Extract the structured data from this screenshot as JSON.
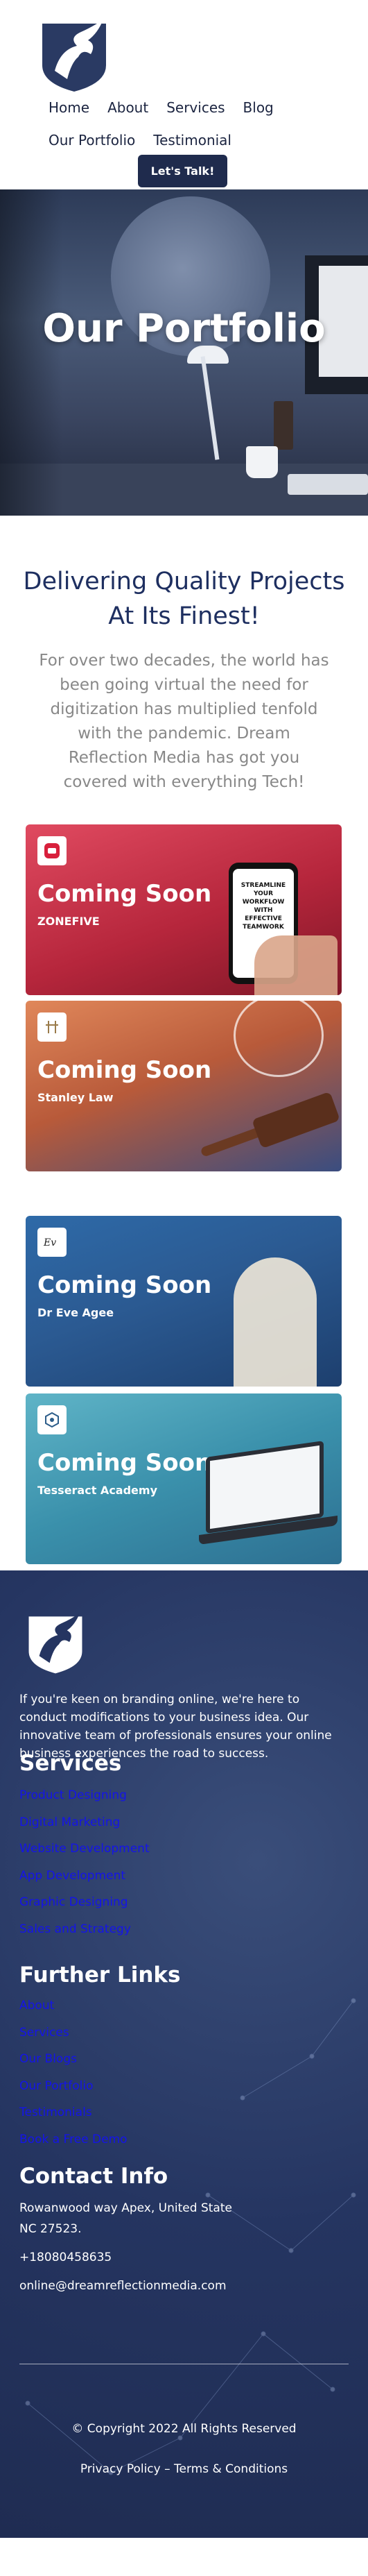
{
  "nav": {
    "row1": [
      "Home",
      "About",
      "Services",
      "Blog"
    ],
    "row2": [
      "Our Portfolio",
      "Testimonial"
    ],
    "cta": "Let's Talk!"
  },
  "hero": {
    "title": "Our Portfolio"
  },
  "intro": {
    "heading": "Delivering Quality Projects At Its Finest!",
    "body": "For over two decades, the world has been going virtual the need for digitization has multiplied tenfold with the pandemic. Dream Reflection Media has got you covered with everything Tech!"
  },
  "cards": [
    {
      "title": "Coming Soon",
      "client": "ZONEFIVE",
      "phone_text": "STREAMLINE YOUR WORKFLOW WITH EFFECTIVE TEAMWORK"
    },
    {
      "title": "Coming Soon",
      "client": "Stanley Law"
    },
    {
      "title": "Coming Soon",
      "client": "Dr Eve Agee"
    },
    {
      "title": "Coming Soon",
      "client": "Tesseract Academy"
    }
  ],
  "footer": {
    "about": "If you're keen on branding online, we're here to conduct modifications to your business idea. Our innovative team of professionals ensures your online business experiences the road to success.",
    "services_heading": "Services",
    "services": [
      "Product Designing",
      "Digital Marketing",
      "Website Development",
      "App Development",
      "Graphic Designing",
      "Sales and Strategy"
    ],
    "links_heading": "Further Links",
    "links": [
      "About",
      "Services",
      "Our Blogs",
      "Our Portfolio",
      "Testimonials",
      "Book a Free Demo"
    ],
    "contact_heading": "Contact Info",
    "address": "Rowanwood way Apex, United State NC 27523.",
    "phone": "+18080458635",
    "email": "online@dreamreflectionmedia.com",
    "copyright": "© Copyright 2022 All Rights Reserved",
    "legal": "Privacy Policy – Terms & Conditions"
  },
  "colors": {
    "navy": "#1f2b4d",
    "heading_blue": "#1e2f60",
    "link_blue": "#1414e8"
  }
}
